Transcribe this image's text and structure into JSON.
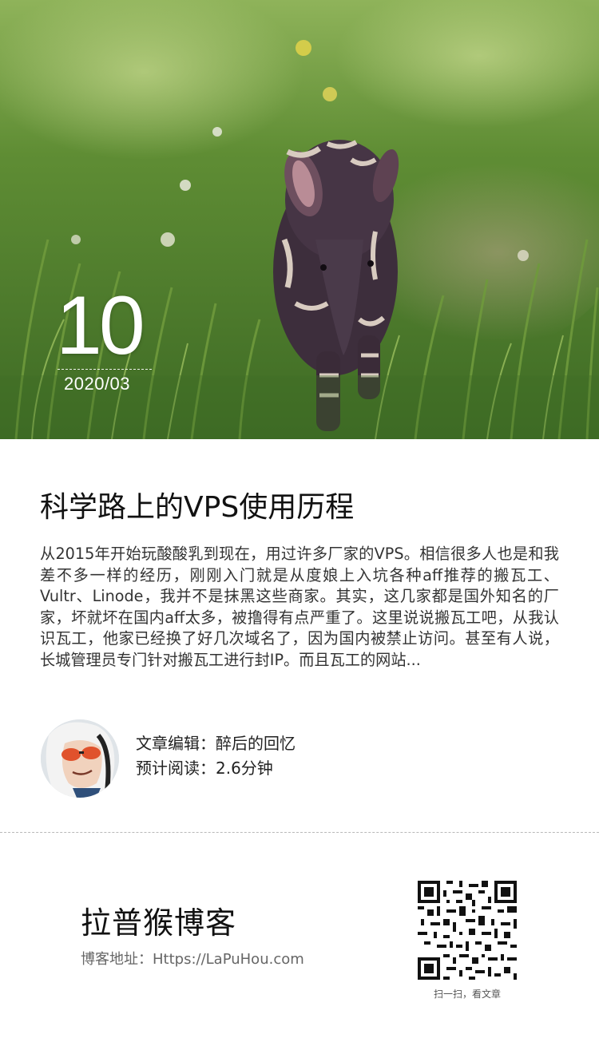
{
  "hero": {
    "image": "tapir-calf-in-grass",
    "date_day": "10",
    "date_year_month": "2020/03"
  },
  "article": {
    "title": "科学路上的VPS使用历程",
    "excerpt": "从2015年开始玩酸酸乳到现在，用过许多厂家的VPS。相信很多人也是和我差不多一样的经历，刚刚入门就是从度娘上入坑各种aff推荐的搬瓦工、Vultr、Linode，我并不是抹黑这些商家。其实，这几家都是国外知名的厂家，坏就坏在国内aff太多，被撸得有点严重了。这里说说搬瓦工吧，从我认识瓦工，他家已经换了好几次域名了，因为国内被禁止访问。甚至有人说，长城管理员专门针对搬瓦工进行封IP。而且瓦工的网站..."
  },
  "author": {
    "avatar_icon": "avatar-icon",
    "editor": "文章编辑：醉后的回忆",
    "reading_time": "预计阅读：2.6分钟"
  },
  "footer": {
    "brand": "拉普猴博客",
    "blog_url": "博客地址：Https://LaPuHou.com",
    "qr_icon": "qr-code-icon",
    "qr_caption": "扫一扫，看文章"
  }
}
